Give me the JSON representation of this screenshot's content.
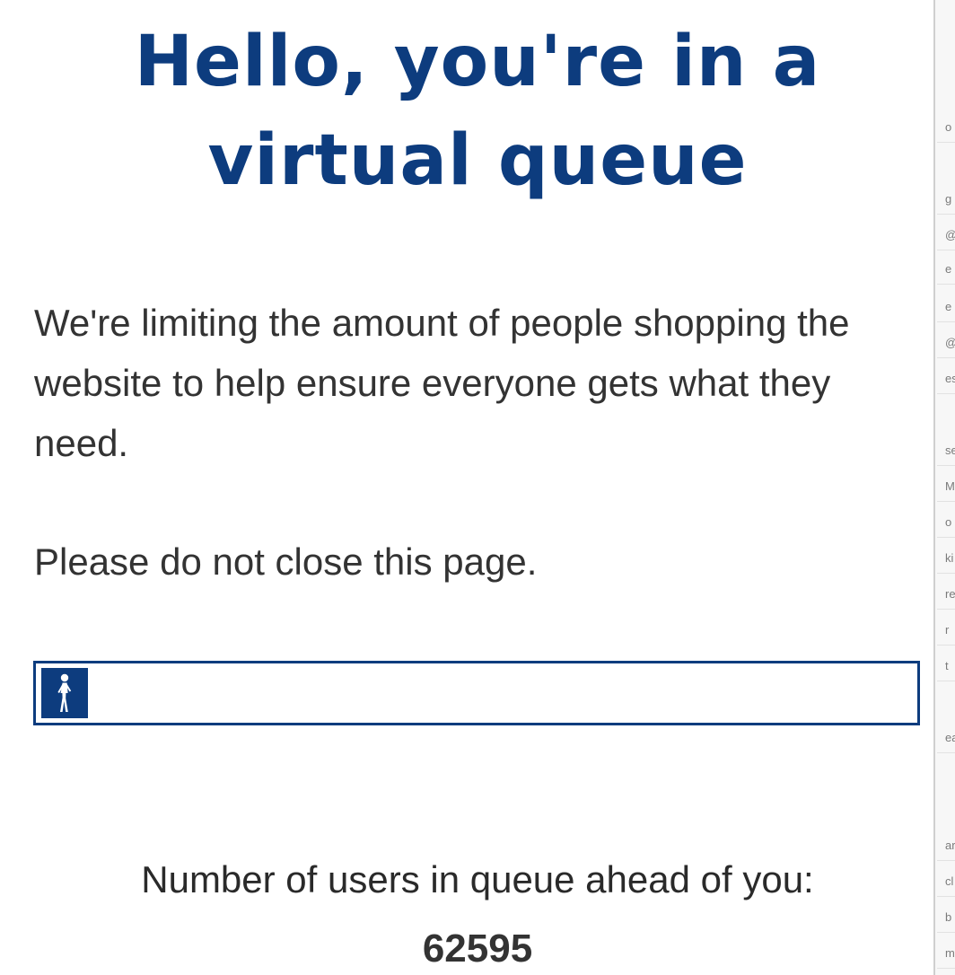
{
  "colors": {
    "brand_blue": "#0d3c7e",
    "body_text": "#333333",
    "background": "#ffffff"
  },
  "queue_page": {
    "title_line1": "Hello, you're in a",
    "title_line2": "virtual queue",
    "intro_text": "We're limiting the amount of people shopping the website to help ensure everyone gets what they need.",
    "warning_text": "Please do not close this page.",
    "progress": {
      "icon": "walking-person-icon",
      "fraction": 0.05
    },
    "queue_label": "Number of users in queue ahead of you:",
    "queue_count": "62595"
  },
  "side_panel": {
    "fragments": [
      "o",
      "g",
      "@",
      "e",
      "e",
      "@",
      "es",
      "se",
      "M",
      "o",
      "ki",
      "re",
      "r",
      "t",
      "ea",
      "ar",
      "cl",
      "b",
      "my"
    ]
  }
}
